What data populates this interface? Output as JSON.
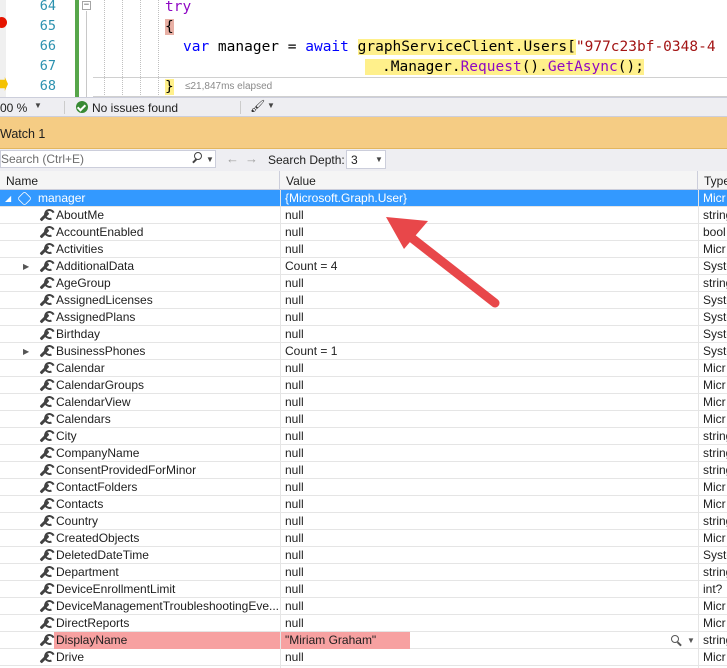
{
  "editor": {
    "line_numbers": [
      "64",
      "65",
      "66",
      "67",
      "68"
    ],
    "lines": {
      "l64": "try",
      "l65": "{",
      "l66_kw1": "var",
      "l66_plain1": " manager = ",
      "l66_kw2": "await",
      "l66_hl": "graphServiceClient.Users[",
      "l66_str": "\"977c23bf-0348-4",
      "l67_plain": ".Manager.",
      "l67_hl_a": "Request",
      "l67_hl_b": "().",
      "l67_hl_c": "GetAsync",
      "l67_hl_d": "();",
      "l68": "}"
    },
    "perf_tip": "≤21,847ms elapsed"
  },
  "status_bar": {
    "zoom": "00 %",
    "issues": "No issues found"
  },
  "watch": {
    "title": "Watch 1",
    "search_placeholder": "Search (Ctrl+E)",
    "search_depth_label": "Search Depth:",
    "search_depth_value": "3",
    "columns": {
      "name": "Name",
      "value": "Value",
      "type": "Type"
    },
    "root": {
      "name": "manager",
      "value": "{Microsoft.Graph.User}",
      "type": "Micr"
    },
    "rows": [
      {
        "name": "AboutMe",
        "value": "null",
        "type": "string"
      },
      {
        "name": "AccountEnabled",
        "value": "null",
        "type": "bool"
      },
      {
        "name": "Activities",
        "value": "null",
        "type": "Micr"
      },
      {
        "name": "AdditionalData",
        "value": "Count = 4",
        "type": "Syste"
      },
      {
        "name": "AgeGroup",
        "value": "null",
        "type": "string"
      },
      {
        "name": "AssignedLicenses",
        "value": "null",
        "type": "Syste"
      },
      {
        "name": "AssignedPlans",
        "value": "null",
        "type": "Syste"
      },
      {
        "name": "Birthday",
        "value": "null",
        "type": "Syste"
      },
      {
        "name": "BusinessPhones",
        "value": "Count = 1",
        "type": "Syste"
      },
      {
        "name": "Calendar",
        "value": "null",
        "type": "Micr"
      },
      {
        "name": "CalendarGroups",
        "value": "null",
        "type": "Micr"
      },
      {
        "name": "CalendarView",
        "value": "null",
        "type": "Micr"
      },
      {
        "name": "Calendars",
        "value": "null",
        "type": "Micr"
      },
      {
        "name": "City",
        "value": "null",
        "type": "string"
      },
      {
        "name": "CompanyName",
        "value": "null",
        "type": "string"
      },
      {
        "name": "ConsentProvidedForMinor",
        "value": "null",
        "type": "string"
      },
      {
        "name": "ContactFolders",
        "value": "null",
        "type": "Micr"
      },
      {
        "name": "Contacts",
        "value": "null",
        "type": "Micr"
      },
      {
        "name": "Country",
        "value": "null",
        "type": "string"
      },
      {
        "name": "CreatedObjects",
        "value": "null",
        "type": "Micr"
      },
      {
        "name": "DeletedDateTime",
        "value": "null",
        "type": "Syste"
      },
      {
        "name": "Department",
        "value": "null",
        "type": "string"
      },
      {
        "name": "DeviceEnrollmentLimit",
        "value": "null",
        "type": "int?"
      },
      {
        "name": "DeviceManagementTroubleshootingEve...",
        "value": "null",
        "type": "Micr"
      },
      {
        "name": "DirectReports",
        "value": "null",
        "type": "Micr"
      },
      {
        "name": "DisplayName",
        "value": "\"Miriam Graham\"",
        "type": "string"
      },
      {
        "name": "Drive",
        "value": "null",
        "type": "Micr"
      }
    ]
  },
  "colors": {
    "selection": "#3399ff",
    "highlight_red": "#f7a1a1",
    "annotation_arrow": "#e8474a",
    "watch_title_bg": "#f5cc84"
  }
}
